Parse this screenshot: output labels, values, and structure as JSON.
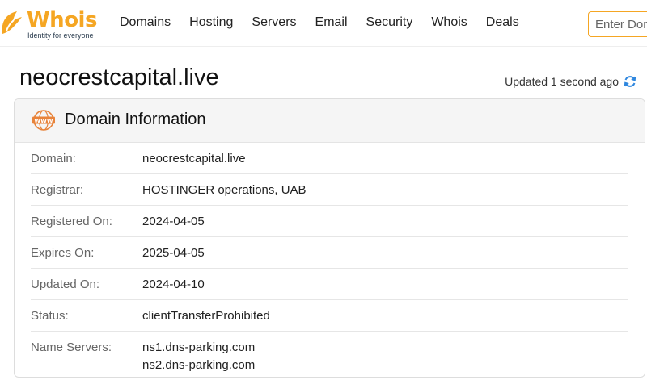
{
  "header": {
    "logo_word": "Whois",
    "logo_tagline": "Identity for everyone",
    "nav": [
      "Domains",
      "Hosting",
      "Servers",
      "Email",
      "Security",
      "Whois",
      "Deals"
    ],
    "search_placeholder": "Enter Domain",
    "accent_color": "#f5a623"
  },
  "page": {
    "title": "neocrestcapital.live",
    "updated_text": "Updated 1 second ago",
    "refresh_icon": "refresh-icon"
  },
  "card": {
    "title": "Domain Information",
    "icon": "www-icon",
    "rows": [
      {
        "label": "Domain:",
        "value": "neocrestcapital.live"
      },
      {
        "label": "Registrar:",
        "value": "HOSTINGER operations, UAB"
      },
      {
        "label": "Registered On:",
        "value": "2024-04-05"
      },
      {
        "label": "Expires On:",
        "value": "2025-04-05"
      },
      {
        "label": "Updated On:",
        "value": "2024-04-10"
      },
      {
        "label": "Status:",
        "value": "clientTransferProhibited"
      }
    ],
    "name_servers": {
      "label": "Name Servers:",
      "values": [
        "ns1.dns-parking.com",
        "ns2.dns-parking.com"
      ]
    }
  }
}
